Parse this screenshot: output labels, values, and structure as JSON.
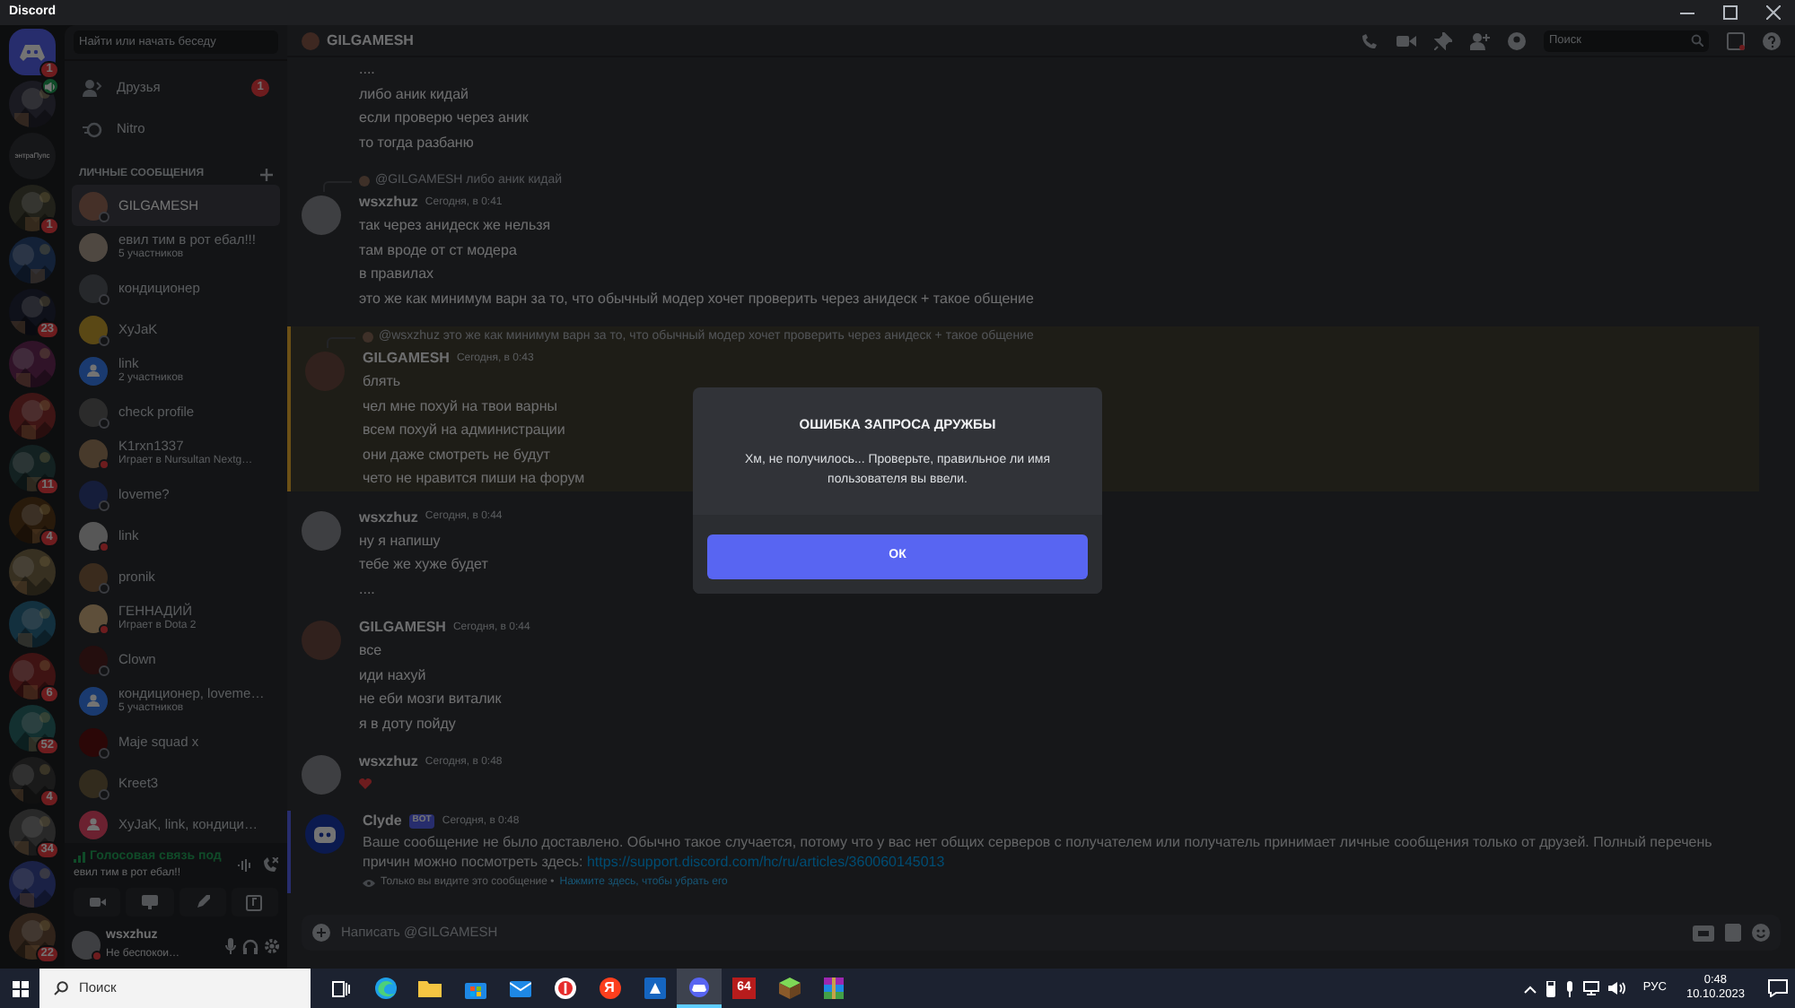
{
  "window": {
    "title": "Discord"
  },
  "servers": [
    {
      "kind": "home",
      "badge": "1",
      "in_voice": false
    },
    {
      "kind": "picture",
      "in_voice": true
    },
    {
      "kind": "text",
      "label": "энтраПупс",
      "in_voice": false
    },
    {
      "kind": "picture",
      "badge": "1",
      "in_voice": false
    },
    {
      "kind": "picture",
      "in_voice": false
    },
    {
      "kind": "picture",
      "badge": "23",
      "in_voice": false
    },
    {
      "kind": "picture",
      "in_voice": false
    },
    {
      "kind": "picture",
      "in_voice": false
    },
    {
      "kind": "picture",
      "badge": "11",
      "in_voice": false
    },
    {
      "kind": "picture",
      "badge": "4",
      "in_voice": false
    },
    {
      "kind": "picture",
      "in_voice": false
    },
    {
      "kind": "picture",
      "in_voice": false
    },
    {
      "kind": "picture",
      "badge": "6",
      "in_voice": false
    },
    {
      "kind": "picture",
      "badge": "52",
      "in_voice": false
    },
    {
      "kind": "picture",
      "badge": "4",
      "in_voice": false
    },
    {
      "kind": "picture",
      "badge": "34",
      "in_voice": false
    },
    {
      "kind": "picture",
      "in_voice": false
    },
    {
      "kind": "picture",
      "badge": "22",
      "in_voice": false
    }
  ],
  "sidebar": {
    "search": {
      "placeholder": "Найти или начать беседу"
    },
    "nav": [
      {
        "kind": "friends",
        "label": "Друзья",
        "badge": "1"
      },
      {
        "kind": "nitro",
        "label": "Nitro"
      }
    ],
    "section": "ЛИЧНЫЕ СООБЩЕНИЯ",
    "dms": [
      {
        "kind": "user",
        "name": "GILGAMESH",
        "dnd": false,
        "selected": true
      },
      {
        "kind": "user",
        "name": "евил тим в рот ебал!!!",
        "subtitle": "5 участников",
        "selected": false
      },
      {
        "kind": "user",
        "name": "кондиционер",
        "dnd": false,
        "selected": false
      },
      {
        "kind": "user",
        "name": "XyJaK",
        "dnd": false,
        "selected": false
      },
      {
        "kind": "group",
        "name": "link",
        "subtitle": "2 участников",
        "selected": false
      },
      {
        "kind": "user",
        "name": "check profile",
        "dnd": false,
        "selected": false
      },
      {
        "kind": "user",
        "name": "K1rxn1337",
        "subtitle": "Играет в Nursultan Nextg…",
        "dnd": true,
        "selected": false
      },
      {
        "kind": "user",
        "name": "loveme?",
        "dnd": false,
        "selected": false
      },
      {
        "kind": "user",
        "name": "link",
        "dnd": true,
        "selected": false
      },
      {
        "kind": "user",
        "name": "pronik",
        "dnd": false,
        "selected": false
      },
      {
        "kind": "user",
        "name": "ГЕННАДИЙ",
        "subtitle": "Играет в Dota 2",
        "dnd": true,
        "selected": false
      },
      {
        "kind": "user",
        "name": "Clown",
        "dnd": false,
        "selected": false
      },
      {
        "kind": "group",
        "name": "кондиционер, loveme…",
        "subtitle": "5 участников",
        "selected": false
      },
      {
        "kind": "user",
        "name": "Maje squad x",
        "dnd": false,
        "selected": false
      },
      {
        "kind": "user",
        "name": "Kreet3",
        "dnd": false,
        "selected": false
      },
      {
        "kind": "group",
        "name": "XyJaK, link, кондици…",
        "selected": false
      }
    ],
    "voice": {
      "status": "Голосовая связь под",
      "channel": "евил тим в рот ебал!!"
    },
    "user": {
      "name": "wsxzhuz",
      "status": "Не беспокои…"
    }
  },
  "chat": {
    "title": "GILGAMESH",
    "search": {
      "placeholder": "Поиск"
    },
    "messages": [
      {
        "kind": "continuation",
        "lines": [
          "....",
          "либо аник кидай",
          "если проверю через аник",
          "то тогда разбаню"
        ]
      },
      {
        "kind": "text",
        "reply": "@GILGAMESH либо аник кидай",
        "author": "wsxzhuz",
        "time": "Сегодня, в 0:41",
        "mention": false,
        "lines": [
          "так через анидеск же нельзя",
          "там вроде от ст модера",
          "в правилах",
          "это же как минимум варн за то, что обычный модер хочет проверить через анидеск + такое общение"
        ]
      },
      {
        "kind": "text",
        "reply": "@wsxzhuz это же как минимум варн за то, что обычный модер хочет проверить через анидеск + такое общение",
        "author": "GILGAMESH",
        "time": "Сегодня, в 0:43",
        "mention": true,
        "lines": [
          "блять",
          "чел мне похуй на твои варны",
          "всем похуй на администрации",
          "они даже смотреть не будут",
          "чето не нравится пиши на форум"
        ]
      },
      {
        "kind": "text",
        "author": "wsxzhuz",
        "time": "Сегодня, в 0:44",
        "mention": false,
        "lines": [
          "ну я напишу",
          "тебе же хуже будет",
          "...."
        ]
      },
      {
        "kind": "text",
        "author": "GILGAMESH",
        "time": "Сегодня, в 0:44",
        "mention": false,
        "lines": [
          "все",
          "иди нахуй",
          "не еби мозги виталик",
          "я в доту пойду"
        ]
      },
      {
        "kind": "emoji",
        "author": "wsxzhuz",
        "time": "Сегодня, в 0:48",
        "mention": false
      },
      {
        "kind": "system",
        "author": "Clyde",
        "tag": "BOT",
        "time": "Сегодня, в 0:48",
        "text": "Ваше сообщение не было доставлено. Обычно такое случается, потому что у вас нет общих серверов с получателем или получатель принимает личные сообщения только от друзей. Полный перечень причин можно посмотреть здесь:",
        "link": "https://support.discord.com/hc/ru/articles/360060145013",
        "note": "Только вы видите это сообщение •",
        "dismiss": "Нажмите здесь, чтобы убрать его"
      }
    ],
    "input": {
      "placeholder": "Написать @GILGAMESH"
    }
  },
  "dialog": {
    "title": "ОШИБКА ЗАПРОСА ДРУЖБЫ",
    "text": "Хм, не получилось... Проверьте, правильное ли имя пользователя вы ввели.",
    "button": "ОК"
  },
  "taskbar": {
    "search": {
      "placeholder": "Поиск"
    },
    "apps": [
      {
        "kind": "taskview",
        "active": false
      },
      {
        "kind": "edge",
        "active": false
      },
      {
        "kind": "explorer",
        "active": false
      },
      {
        "kind": "store",
        "active": false
      },
      {
        "kind": "mail",
        "active": false
      },
      {
        "kind": "yabrowser",
        "active": false
      },
      {
        "kind": "yandex",
        "label": "Я",
        "active": false
      },
      {
        "kind": "blueapp",
        "active": false
      },
      {
        "kind": "discord",
        "active": true
      },
      {
        "kind": "aida",
        "label": "64",
        "active": false
      },
      {
        "kind": "cube",
        "active": false
      },
      {
        "kind": "archive",
        "active": false
      }
    ],
    "language": "РУС",
    "time": "0:48",
    "date": "10.10.2023"
  }
}
